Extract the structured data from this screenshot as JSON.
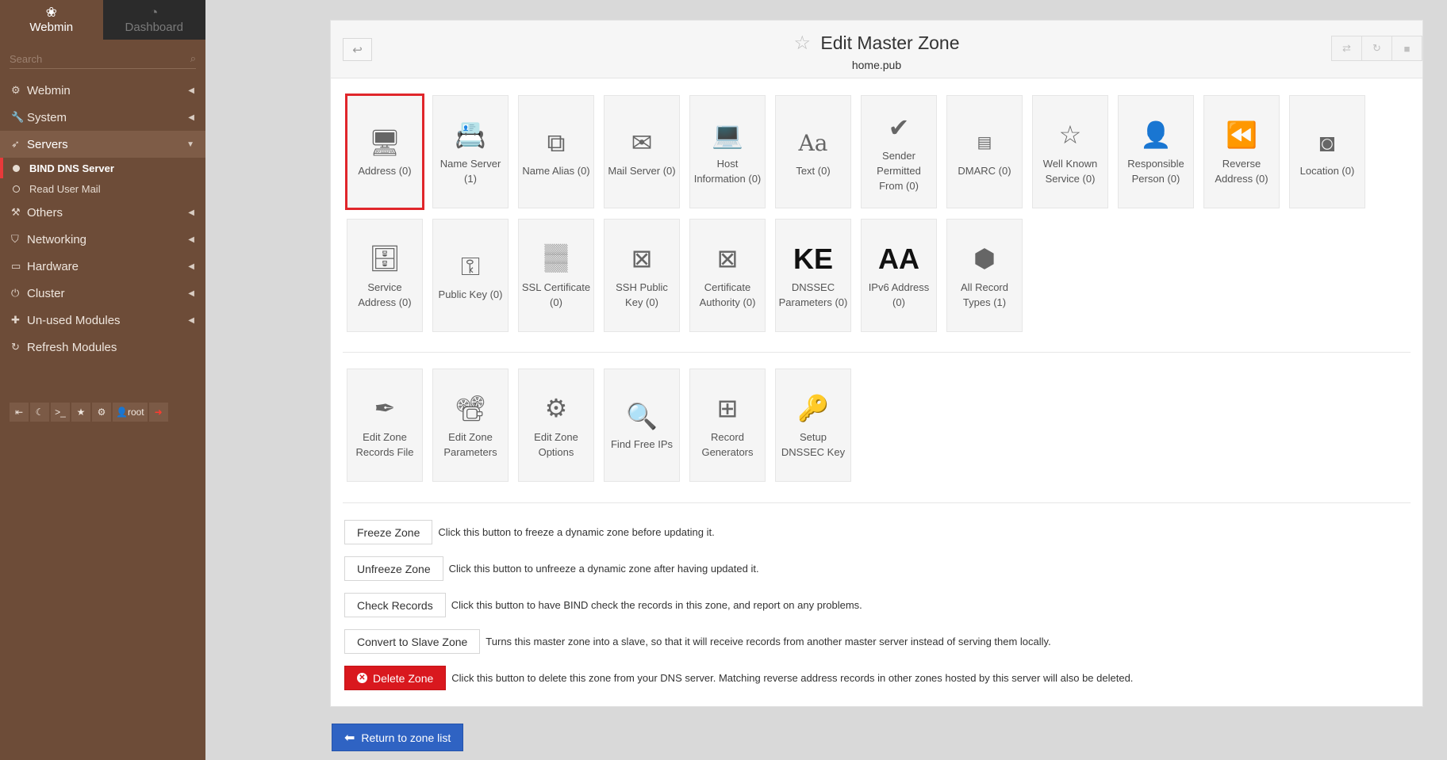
{
  "sidebar": {
    "brand": "Webmin",
    "dashboard": "Dashboard",
    "search_placeholder": "Search",
    "items": [
      {
        "label": "Webmin",
        "icon": "gear-icon"
      },
      {
        "label": "System",
        "icon": "wrench-icon"
      },
      {
        "label": "Servers",
        "icon": "rocket-icon",
        "active": true
      },
      {
        "label": "Others",
        "icon": "tools-icon"
      },
      {
        "label": "Networking",
        "icon": "shield-icon"
      },
      {
        "label": "Hardware",
        "icon": "hdd-icon"
      },
      {
        "label": "Cluster",
        "icon": "power-icon"
      },
      {
        "label": "Un-used Modules",
        "icon": "puzzle-icon"
      },
      {
        "label": "Refresh Modules",
        "icon": "refresh-icon"
      }
    ],
    "sub_items": [
      {
        "label": "BIND DNS Server",
        "active": true
      },
      {
        "label": "Read User Mail",
        "active": false
      }
    ],
    "user": "root"
  },
  "header": {
    "title": "Edit Master Zone",
    "subtitle": "home.pub"
  },
  "record_types": [
    {
      "label": "Address (0)",
      "icon": "computer-icon",
      "selected": true
    },
    {
      "label": "Name Server (1)",
      "icon": "card-icon"
    },
    {
      "label": "Name Alias (0)",
      "icon": "windows-icon"
    },
    {
      "label": "Mail Server (0)",
      "icon": "mail-icon"
    },
    {
      "label": "Host Information (0)",
      "icon": "laptop-icon"
    },
    {
      "label": "Text (0)",
      "icon": "text-icon"
    },
    {
      "label": "Sender Permitted From (0)",
      "icon": "checkbadge-icon"
    },
    {
      "label": "DMARC (0)",
      "icon": "dmarc-icon"
    },
    {
      "label": "Well Known Service (0)",
      "icon": "star-icon"
    },
    {
      "label": "Responsible Person (0)",
      "icon": "person-icon"
    },
    {
      "label": "Reverse Address (0)",
      "icon": "rewind-icon"
    },
    {
      "label": "Location (0)",
      "icon": "location-icon"
    },
    {
      "label": "Service Address (0)",
      "icon": "server-icon"
    },
    {
      "label": "Public Key (0)",
      "icon": "key-icon"
    },
    {
      "label": "SSL Certificate (0)",
      "icon": "certificate-text-icon"
    },
    {
      "label": "SSH Public Key (0)",
      "icon": "broken-image-icon"
    },
    {
      "label": "Certificate Authority (0)",
      "icon": "broken-image-icon"
    },
    {
      "label": "DNSSEC Parameters (0)",
      "icon": "ke-icon"
    },
    {
      "label": "IPv6 Address (0)",
      "icon": "aa-icon"
    },
    {
      "label": "All Record Types (1)",
      "icon": "cubes-icon"
    }
  ],
  "zone_tools": [
    {
      "label": "Edit Zone Records File",
      "icon": "feather-icon"
    },
    {
      "label": "Edit Zone Parameters",
      "icon": "projector-icon"
    },
    {
      "label": "Edit Zone Options",
      "icon": "cog-icon"
    },
    {
      "label": "Find Free IPs",
      "icon": "magnifier-icon"
    },
    {
      "label": "Record Generators",
      "icon": "wand-icon"
    },
    {
      "label": "Setup DNSSEC Key",
      "icon": "gold-key-icon"
    }
  ],
  "actions": [
    {
      "button": "Freeze Zone",
      "desc": "Click this button to freeze a dynamic zone before updating it."
    },
    {
      "button": "Unfreeze Zone",
      "desc": "Click this button to unfreeze a dynamic zone after having updated it."
    },
    {
      "button": "Check Records",
      "desc": "Click this button to have BIND check the records in this zone, and report on any problems."
    },
    {
      "button": "Convert to Slave Zone",
      "desc": "Turns this master zone into a slave, so that it will receive records from another master server instead of serving them locally."
    },
    {
      "button": "Delete Zone",
      "desc": "Click this button to delete this zone from your DNS server. Matching reverse address records in other zones hosted by this server will also be deleted."
    }
  ],
  "return_label": "Return to zone list"
}
